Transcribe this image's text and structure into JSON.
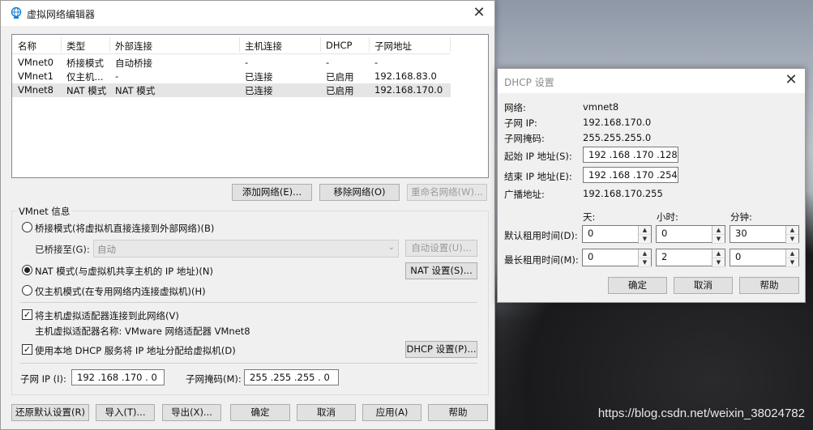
{
  "main_window": {
    "title": "虚拟网络编辑器",
    "columns": [
      "名称",
      "类型",
      "外部连接",
      "主机连接",
      "DHCP",
      "子网地址"
    ],
    "rows": [
      [
        "VMnet0",
        "桥接模式",
        "自动桥接",
        "-",
        "-",
        "-"
      ],
      [
        "VMnet1",
        "仅主机...",
        "-",
        "已连接",
        "已启用",
        "192.168.83.0"
      ],
      [
        "VMnet8",
        "NAT 模式",
        "NAT 模式",
        "已连接",
        "已启用",
        "192.168.170.0"
      ]
    ],
    "add_network": "添加网络(E)...",
    "remove_network": "移除网络(O)",
    "rename_network": "重命名网络(W)...",
    "vmnet_info_label": "VMnet 信息",
    "bridge_radio": "桥接模式(将虚拟机直接连接到外部网络)(B)",
    "bridged_to_label": "已桥接至(G):",
    "bridged_to_value": "自动",
    "auto_settings": "自动设置(U)...",
    "nat_radio": "NAT 模式(与虚拟机共享主机的 IP 地址)(N)",
    "nat_settings": "NAT 设置(S)...",
    "hostonly_radio": "仅主机模式(在专用网络内连接虚拟机)(H)",
    "connect_adapter_check": "将主机虚拟适配器连接到此网络(V)",
    "adapter_name": "主机虚拟适配器名称: VMware 网络适配器 VMnet8",
    "dhcp_check": "使用本地 DHCP 服务将 IP 地址分配给虚拟机(D)",
    "dhcp_settings": "DHCP 设置(P)...",
    "subnet_ip_label": "子网 IP (I):",
    "subnet_ip_value": "192 .168 .170 . 0",
    "subnet_mask_label": "子网掩码(M):",
    "subnet_mask_value": "255 .255 .255 . 0",
    "restore_defaults": "还原默认设置(R)",
    "import": "导入(T)...",
    "export": "导出(X)...",
    "ok": "确定",
    "cancel": "取消",
    "apply": "应用(A)",
    "help": "帮助"
  },
  "dhcp_window": {
    "title": "DHCP 设置",
    "network_label": "网络:",
    "network_value": "vmnet8",
    "subnet_ip_label": "子网 IP:",
    "subnet_ip_value": "192.168.170.0",
    "subnet_mask_label": "子网掩码:",
    "subnet_mask_value": "255.255.255.0",
    "start_ip_label": "起始 IP 地址(S):",
    "start_ip_value": "192 .168 .170 .128",
    "end_ip_label": "结束 IP 地址(E):",
    "end_ip_value": "192 .168 .170 .254",
    "broadcast_label": "广播地址:",
    "broadcast_value": "192.168.170.255",
    "col_days": "天:",
    "col_hours": "小时:",
    "col_minutes": "分钟:",
    "default_lease_label": "默认租用时间(D):",
    "default_lease": [
      "0",
      "0",
      "30"
    ],
    "max_lease_label": "最长租用时间(M):",
    "max_lease": [
      "0",
      "2",
      "0"
    ],
    "ok": "确定",
    "cancel": "取消",
    "help": "帮助"
  },
  "watermark": "https://blog.csdn.net/weixin_38024782"
}
